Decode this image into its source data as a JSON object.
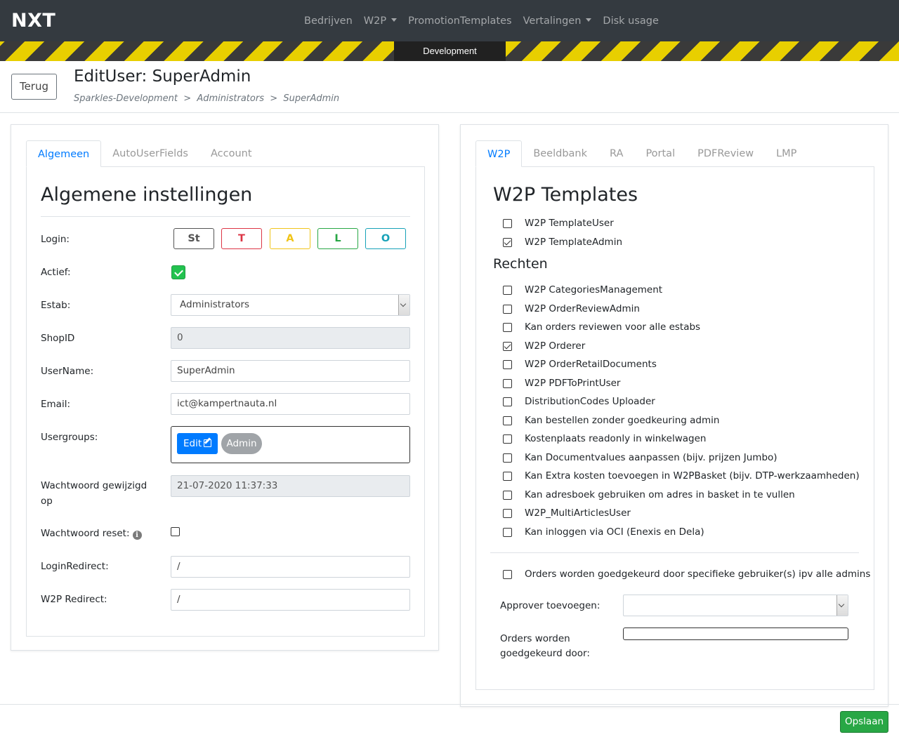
{
  "navbar": {
    "brand": "NXT",
    "links": [
      "Bedrijven",
      "W2P",
      "PromotionTemplates",
      "Vertalingen",
      "Disk usage"
    ],
    "environment": "Development"
  },
  "header": {
    "back_label": "Terug",
    "title": "EditUser: SuperAdmin",
    "breadcrumb": "Sparkles-Development  >  Administrators  >  SuperAdmin"
  },
  "left": {
    "tabs": [
      "Algemeen",
      "AutoUserFields",
      "Account"
    ],
    "active_tab": "Algemeen",
    "section_title": "Algemene instellingen",
    "login_label": "Login:",
    "login_buttons": [
      {
        "label": "St",
        "color": "#555555"
      },
      {
        "label": "T",
        "color": "#dc3545"
      },
      {
        "label": "A",
        "color": "#f0c419"
      },
      {
        "label": "L",
        "color": "#28a745"
      },
      {
        "label": "O",
        "color": "#17a2b8"
      }
    ],
    "actief_label": "Actief:",
    "actief_checked": true,
    "estab_label": "Estab:",
    "estab_value": "Administrators",
    "shopid_label": "ShopID",
    "shopid_value": "0",
    "username_label": "UserName:",
    "username_value": "SuperAdmin",
    "email_label": "Email:",
    "email_value": "ict@kampertnauta.nl",
    "usergroups_label": "Usergroups:",
    "usergroups_edit": "Edit",
    "usergroups_badge": "Admin",
    "pw_changed_label_1": "Wachtwoord gewijzigd",
    "pw_changed_label_2": "op",
    "pw_changed_value": "21-07-2020 11:37:33",
    "pw_reset_label": "Wachtwoord reset:",
    "pw_reset_checked": false,
    "login_redirect_label": "LoginRedirect:",
    "login_redirect_value": "/",
    "w2p_redirect_label": "W2P Redirect:",
    "w2p_redirect_value": "/"
  },
  "right": {
    "tabs": [
      "W2P",
      "Beeldbank",
      "RA",
      "Portal",
      "PDFReview",
      "LMP"
    ],
    "active_tab": "W2P",
    "section_title": "W2P Templates",
    "templates": [
      {
        "label": "W2P TemplateUser",
        "checked": false
      },
      {
        "label": "W2P TemplateAdmin",
        "checked": true
      }
    ],
    "rights_title": "Rechten",
    "rights": [
      {
        "label": "W2P CategoriesManagement",
        "checked": false
      },
      {
        "label": "W2P OrderReviewAdmin",
        "checked": false
      },
      {
        "label": "Kan orders reviewen voor alle estabs",
        "checked": false
      },
      {
        "label": "W2P Orderer",
        "checked": true
      },
      {
        "label": "W2P OrderRetailDocuments",
        "checked": false
      },
      {
        "label": "W2P PDFToPrintUser",
        "checked": false
      },
      {
        "label": "DistributionCodes Uploader",
        "checked": false
      },
      {
        "label": "Kan bestellen zonder goedkeuring admin",
        "checked": false
      },
      {
        "label": "Kostenplaats readonly in winkelwagen",
        "checked": false
      },
      {
        "label": "Kan Documentvalues aanpassen (bijv. prijzen Jumbo)",
        "checked": false
      },
      {
        "label": "Kan Extra kosten toevoegen in W2PBasket (bijv. DTP-werkzaamheden)",
        "checked": false
      },
      {
        "label": "Kan adresboek gebruiken om adres in basket in te vullen",
        "checked": false
      },
      {
        "label": "W2P_MultiArticlesUser",
        "checked": false
      },
      {
        "label": "Kan inloggen via OCI (Enexis en Dela)",
        "checked": false
      }
    ],
    "approval_label": "Orders worden goedgekeurd door specifieke gebruiker(s) ipv alle admins",
    "approval_checked": false,
    "approver_add_label": "Approver toevoegen:",
    "approver_add_value": "",
    "approved_by_label_1": "Orders worden",
    "approved_by_label_2": "goedgekeurd door:"
  },
  "footer": {
    "save_label": "Opslaan"
  }
}
